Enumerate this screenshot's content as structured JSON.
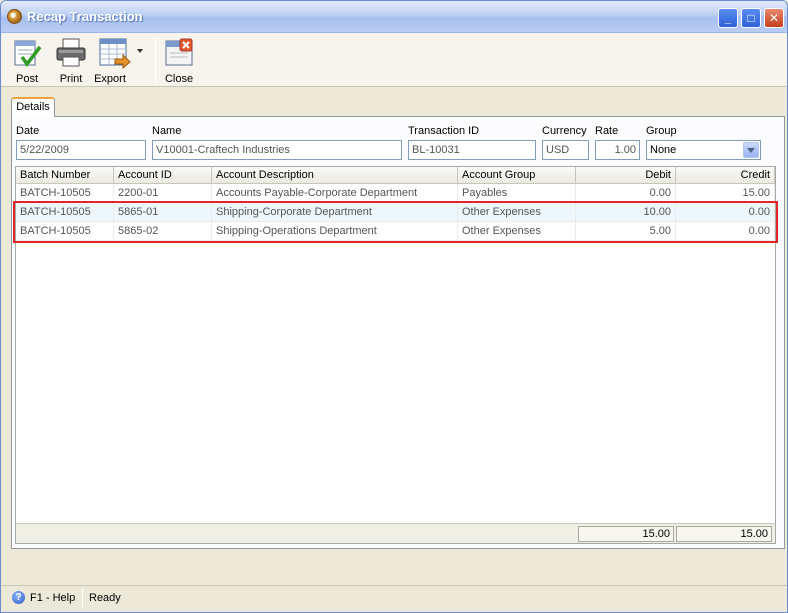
{
  "window": {
    "title": "Recap Transaction",
    "controls": {
      "minimize": "_",
      "maximize": "□",
      "close": "✕"
    }
  },
  "toolbar": {
    "post": "Post",
    "print": "Print",
    "export": "Export",
    "close": "Close"
  },
  "tabs": [
    {
      "label": "Details"
    }
  ],
  "fields": {
    "date": {
      "label": "Date",
      "value": "5/22/2009"
    },
    "name": {
      "label": "Name",
      "value": "V10001-Craftech Industries"
    },
    "transaction_id": {
      "label": "Transaction ID",
      "value": "BL-10031"
    },
    "currency": {
      "label": "Currency",
      "value": "USD"
    },
    "rate": {
      "label": "Rate",
      "value": "1.00"
    },
    "group": {
      "label": "Group",
      "value": "None"
    }
  },
  "grid": {
    "columns": [
      "Batch Number",
      "Account ID",
      "Account Description",
      "Account Group",
      "Debit",
      "Credit"
    ],
    "rows": [
      {
        "batch": "BATCH-10505",
        "account_id": "2200-01",
        "description": "Accounts Payable-Corporate Department",
        "group": "Payables",
        "debit": "0.00",
        "credit": "15.00"
      },
      {
        "batch": "BATCH-10505",
        "account_id": "5865-01",
        "description": "Shipping-Corporate Department",
        "group": "Other Expenses",
        "debit": "10.00",
        "credit": "0.00"
      },
      {
        "batch": "BATCH-10505",
        "account_id": "5865-02",
        "description": "Shipping-Operations Department",
        "group": "Other Expenses",
        "debit": "5.00",
        "credit": "0.00"
      }
    ],
    "totals": {
      "debit": "15.00",
      "credit": "15.00"
    }
  },
  "statusbar": {
    "help": "F1 - Help",
    "status": "Ready"
  },
  "colors": {
    "highlight": "#e0262a",
    "tab_accent": "#f2a23a"
  }
}
